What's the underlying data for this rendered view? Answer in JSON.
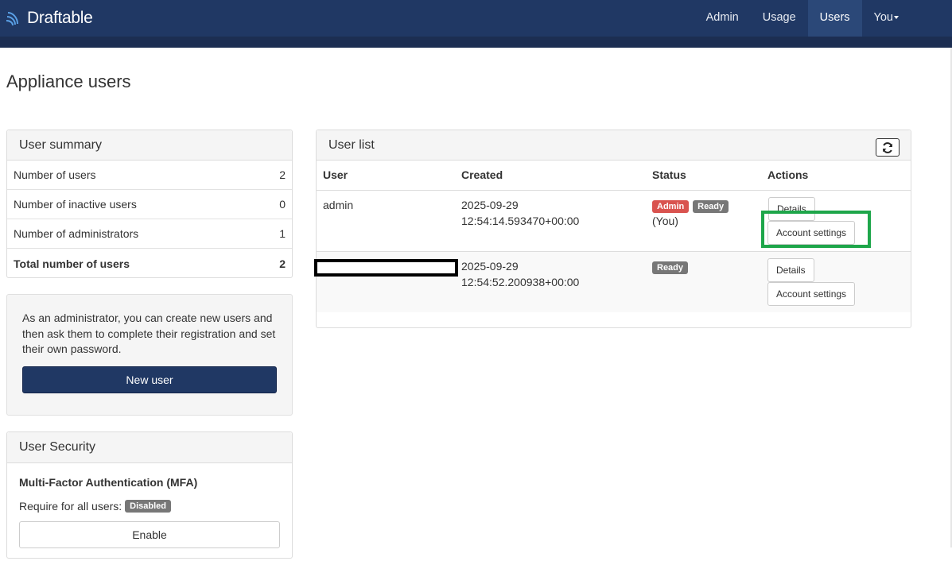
{
  "nav": {
    "brand": "Draftable",
    "items": [
      "Admin",
      "Usage",
      "Users",
      "You"
    ],
    "active": "Users"
  },
  "page": {
    "title": "Appliance users"
  },
  "summary": {
    "heading": "User summary",
    "rows": [
      {
        "label": "Number of users",
        "value": "2"
      },
      {
        "label": "Number of inactive users",
        "value": "0"
      },
      {
        "label": "Number of administrators",
        "value": "1"
      },
      {
        "label": "Total number of users",
        "value": "2"
      }
    ]
  },
  "admin_box": {
    "text": "As an administrator, you can create new users and then ask them to complete their registration and set their own password.",
    "button": "New user"
  },
  "security": {
    "heading": "User Security",
    "mfa_title": "Multi-Factor Authentication (MFA)",
    "require_label": "Require for all users:",
    "status": "Disabled",
    "enable_button": "Enable"
  },
  "user_list": {
    "heading": "User list",
    "columns": [
      "User",
      "Created",
      "Status",
      "Actions"
    ],
    "rows": [
      {
        "user": "admin",
        "created_date": "2025-09-29",
        "created_time": "12:54:14.593470+00:00",
        "badges": [
          "Admin",
          "Ready"
        ],
        "note": "(You)",
        "actions": [
          "Details",
          "Account settings"
        ]
      },
      {
        "user": "",
        "created_date": "2025-09-29",
        "created_time": "12:54:52.200938+00:00",
        "badges": [
          "Ready"
        ],
        "note": "",
        "actions": [
          "Details",
          "Account settings"
        ]
      }
    ]
  },
  "colors": {
    "navbar": "#203864",
    "primary_button": "#203864",
    "badge_admin": "#d9534f",
    "badge_grey": "#777777",
    "highlight": "#1ea64a"
  }
}
